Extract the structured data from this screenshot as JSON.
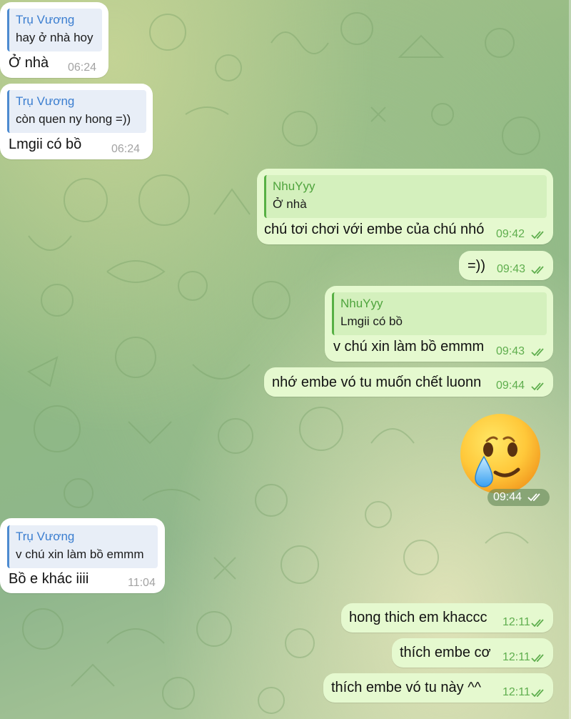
{
  "conversation": {
    "messages": [
      {
        "dir": "in",
        "reply_name": "Trụ Vương",
        "reply_text": "hay ở nhà hoy",
        "text": "Ở nhà",
        "time": "06:24"
      },
      {
        "dir": "in",
        "reply_name": "Trụ Vương",
        "reply_text": "còn quen ny hong =))",
        "text": "Lmgii có bồ",
        "time": "06:24"
      },
      {
        "dir": "out",
        "reply_name": "NhuYyy",
        "reply_text": "Ở nhà",
        "text": "chú tơi chơi với embe của chú nhó",
        "time": "09:42"
      },
      {
        "dir": "out",
        "text": "=))",
        "time": "09:43"
      },
      {
        "dir": "out",
        "reply_name": "NhuYyy",
        "reply_text": "Lmgii có bồ",
        "text": "v chú xin làm bồ emmm",
        "time": "09:43"
      },
      {
        "dir": "out",
        "text": "nhớ embe vó tu muốn chết luonn",
        "time": "09:44"
      },
      {
        "dir": "out",
        "sticker": "smiling-face-with-tear",
        "time": "09:44"
      },
      {
        "dir": "in",
        "reply_name": "Trụ Vương",
        "reply_text": "v chú xin làm bồ emmm",
        "text": "Bồ e khác iiii",
        "time": "11:04"
      },
      {
        "dir": "out",
        "text": "hong thich em khaccc",
        "time": "12:11"
      },
      {
        "dir": "out",
        "text": "thích embe cơ",
        "time": "12:11"
      },
      {
        "dir": "out",
        "text": "thích embe vó tu này  ^^",
        "time": "12:11"
      }
    ]
  },
  "colors": {
    "incoming_bubble": "#ffffff",
    "outgoing_bubble": "#e5f9cf",
    "incoming_reply_accent": "#4d8bd0",
    "outgoing_reply_accent": "#57b044",
    "outgoing_time": "#5fae4e"
  },
  "icons": {
    "read_receipt": "double-check-icon",
    "sticker": "smiling-face-with-tear-icon"
  }
}
